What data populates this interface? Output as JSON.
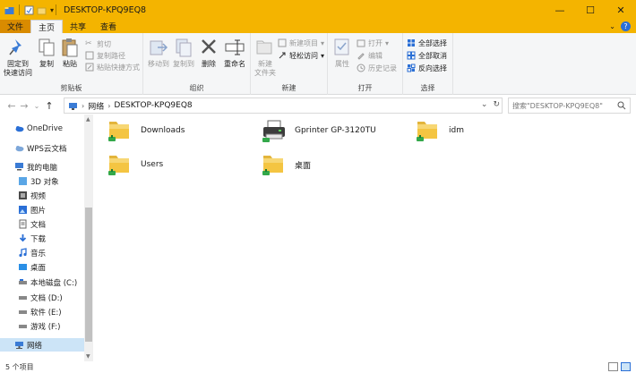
{
  "window": {
    "title": "DESKTOP-KPQ9EQ8",
    "minimize": "—",
    "maximize": "☐",
    "close": "✕"
  },
  "ribbon_tabs": [
    "文件",
    "主页",
    "共享",
    "查看"
  ],
  "ribbon": {
    "clipboard": {
      "label": "剪贴板",
      "pin": "固定到\n快速访问",
      "copy": "复制",
      "paste": "粘贴",
      "cut": "剪切",
      "copy_path": "复制路径",
      "paste_shortcut": "粘贴快捷方式"
    },
    "organize": {
      "label": "组织",
      "move_to": "移动到",
      "copy_to": "复制到",
      "delete": "删除",
      "rename": "重命名"
    },
    "new": {
      "label": "新建",
      "new_folder": "新建\n文件夹",
      "new_item": "新建项目",
      "easy_access": "轻松访问"
    },
    "open": {
      "label": "打开",
      "properties": "属性",
      "open": "打开",
      "edit": "编辑",
      "history": "历史记录"
    },
    "select": {
      "label": "选择",
      "select_all": "全部选择",
      "select_none": "全部取消",
      "invert": "反向选择"
    }
  },
  "address": {
    "segments": [
      "网络",
      "DESKTOP-KPQ9EQ8"
    ],
    "search_placeholder": "搜索\"DESKTOP-KPQ9EQ8\""
  },
  "nav_items": [
    {
      "label": "OneDrive",
      "icon": "cloud-icon"
    },
    {
      "label": "WPS云文档",
      "icon": "cloud-icon"
    },
    {
      "label": "我的电脑",
      "icon": "computer-icon"
    },
    {
      "label": "3D 对象",
      "icon": "3d-objects-icon"
    },
    {
      "label": "视频",
      "icon": "video-icon"
    },
    {
      "label": "图片",
      "icon": "pictures-icon"
    },
    {
      "label": "文档",
      "icon": "documents-icon"
    },
    {
      "label": "下载",
      "icon": "download-icon"
    },
    {
      "label": "音乐",
      "icon": "music-icon"
    },
    {
      "label": "桌面",
      "icon": "desktop-icon"
    },
    {
      "label": "本地磁盘 (C:)",
      "icon": "drive-icon"
    },
    {
      "label": "文档 (D:)",
      "icon": "drive-icon"
    },
    {
      "label": "软件 (E:)",
      "icon": "drive-icon"
    },
    {
      "label": "游戏 (F:)",
      "icon": "drive-icon"
    },
    {
      "label": "网络",
      "icon": "network-icon"
    }
  ],
  "items": [
    {
      "label": "Downloads",
      "icon": "shared-folder-icon"
    },
    {
      "label": "Gprinter  GP-3120TU",
      "icon": "printer-icon"
    },
    {
      "label": "idm",
      "icon": "shared-folder-icon"
    },
    {
      "label": "Users",
      "icon": "shared-folder-icon"
    },
    {
      "label": "桌面",
      "icon": "shared-folder-icon"
    }
  ],
  "status": {
    "count": "5 个项目"
  },
  "colors": {
    "title_bar": "#f4b400",
    "file_tab": "#d98b00",
    "selection": "#cce4f7"
  }
}
